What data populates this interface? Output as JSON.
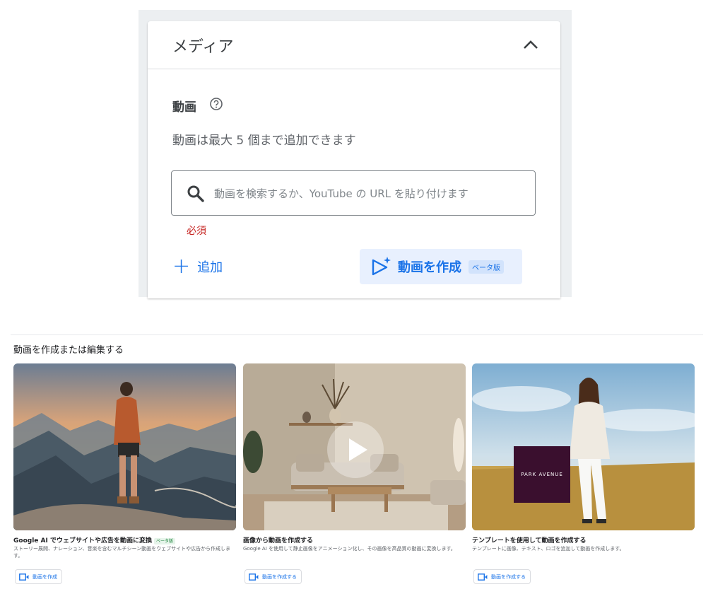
{
  "media_panel": {
    "title": "メディア",
    "video_section": {
      "label": "動画",
      "description": "動画は最大 5 個まで追加できます"
    },
    "search": {
      "placeholder": "動画を検索するか、YouTube の URL を貼り付けます",
      "value": ""
    },
    "required_text": "必須",
    "add_label": "追加",
    "create_video": {
      "label": "動画を作成",
      "badge": "ベータ版"
    }
  },
  "create_section": {
    "title": "動画を作成または編集する",
    "tiles": [
      {
        "title": "Google AI でウェブサイトや広告を動画に変換",
        "badge": "ベータ版",
        "description": "ストーリー展開、ナレーション、音楽を含むマルチシーン動画をウェブサイトや広告から作成します。",
        "button_label": "動画を作成",
        "image": "mountain-hiker"
      },
      {
        "title": "画像から動画を作成する",
        "description": "Google AI を使用して静止画像をアニメーション化し、その画像を高品質の動画に変換します。",
        "button_label": "動画を作成する",
        "image": "living-room-interior"
      },
      {
        "title": "テンプレートを使用して動画を作成する",
        "description": "テンプレートに画像、テキスト、ロゴを追加して動画を作成します。",
        "button_label": "動画を作成する",
        "image": "woman-in-field",
        "brand_text": "PARK AVENUE"
      }
    ]
  },
  "colors": {
    "accent": "#1a73e8",
    "required": "#c5221f",
    "beta_green": "#188038",
    "brand_square": "#3a0f2e"
  },
  "icons": [
    "chevron-up-icon",
    "help-icon",
    "search-icon",
    "plus-icon",
    "sparkle-play-icon",
    "video-icon",
    "play-icon"
  ]
}
